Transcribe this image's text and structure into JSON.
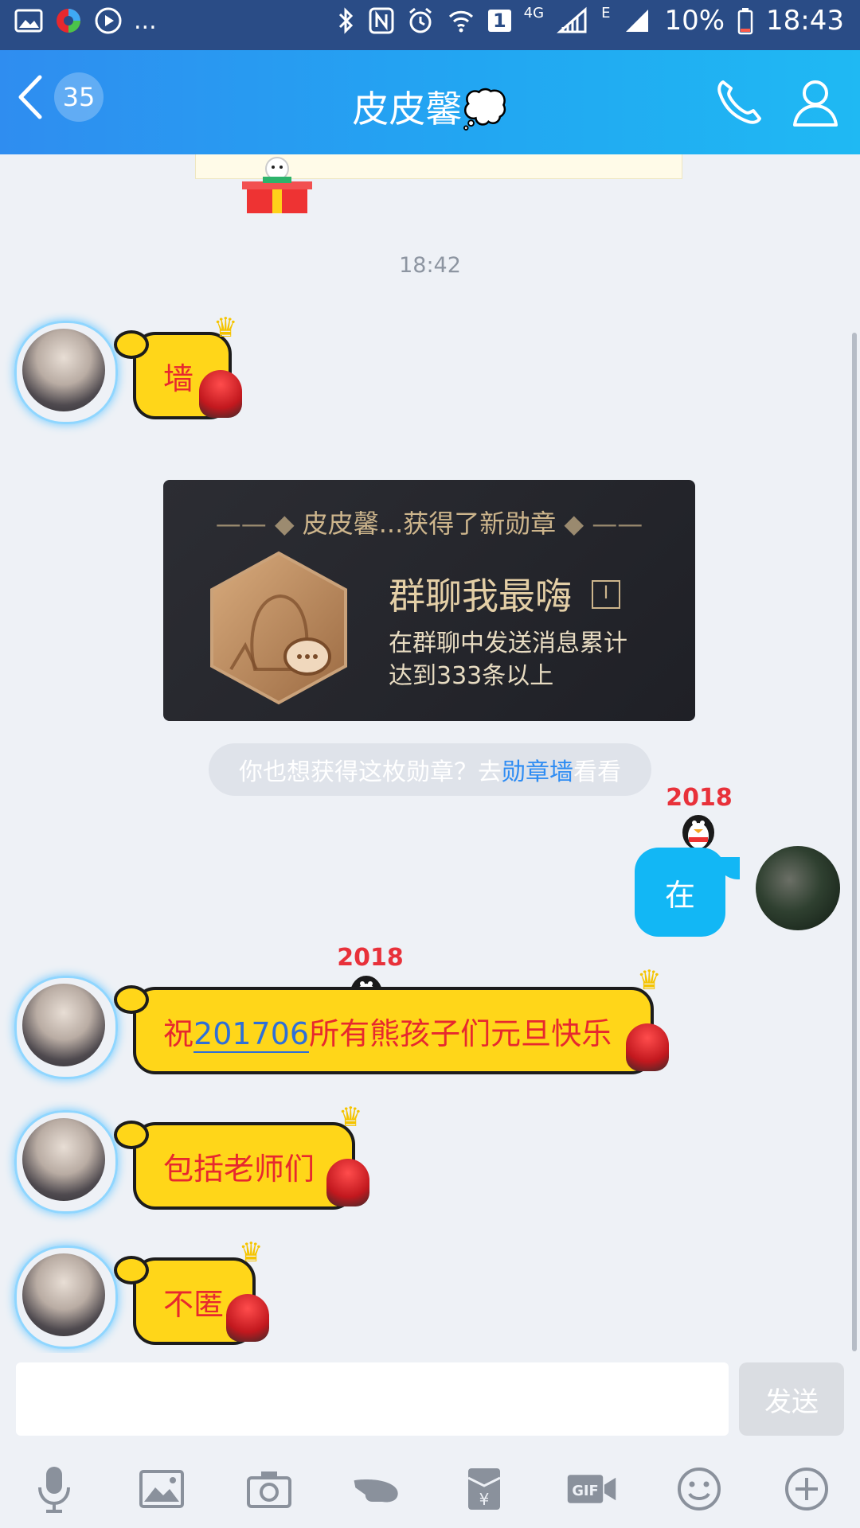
{
  "status_bar": {
    "left_more": "...",
    "sim_badge": "1",
    "net_4g": "4G",
    "net_e": "E",
    "battery": "10%",
    "time": "18:43"
  },
  "header": {
    "unread_count": "35",
    "title": "皮皮馨💭"
  },
  "chat": {
    "timestamp": "18:42",
    "messages": [
      {
        "text": "墙"
      },
      {
        "text_prefix": "祝",
        "text_link": "201706",
        "text_suffix": "所有熊孩子们元旦快乐"
      },
      {
        "text": "包括老师们"
      },
      {
        "text": "不匿"
      }
    ],
    "my_message": "在",
    "badge": {
      "header": "皮皮馨...获得了新勋章",
      "name": "群聊我最嗨",
      "index": "I",
      "desc_line1": "在群聊中发送消息累计",
      "desc_line2": "达到333条以上"
    },
    "hint": {
      "prefix": "你也想获得这枚勋章？去",
      "link": "勋章墙",
      "suffix": "看看"
    },
    "sticker_year": "2018"
  },
  "input": {
    "send_label": "发送"
  },
  "toolbar_icons": [
    "mic-icon",
    "image-icon",
    "camera-icon",
    "poke-icon",
    "red-packet-icon",
    "gif-icon",
    "emoji-icon",
    "plus-icon"
  ],
  "colors": {
    "status_bar": "#2a4c86",
    "title_bar": "#22a6f2",
    "bubble_yellow": "#ffd619",
    "bubble_text_red": "#e7282e",
    "my_bubble": "#12b7f5",
    "link_blue": "#2e8cf3"
  }
}
